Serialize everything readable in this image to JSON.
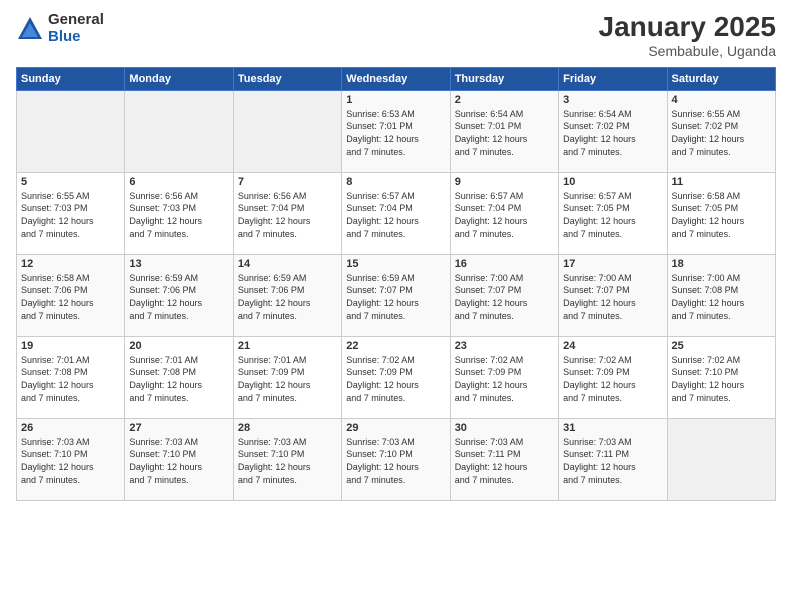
{
  "logo": {
    "general": "General",
    "blue": "Blue"
  },
  "header": {
    "month": "January 2025",
    "location": "Sembabule, Uganda"
  },
  "weekdays": [
    "Sunday",
    "Monday",
    "Tuesday",
    "Wednesday",
    "Thursday",
    "Friday",
    "Saturday"
  ],
  "weeks": [
    [
      {
        "day": "",
        "info": ""
      },
      {
        "day": "",
        "info": ""
      },
      {
        "day": "",
        "info": ""
      },
      {
        "day": "1",
        "info": "Sunrise: 6:53 AM\nSunset: 7:01 PM\nDaylight: 12 hours\nand 7 minutes."
      },
      {
        "day": "2",
        "info": "Sunrise: 6:54 AM\nSunset: 7:01 PM\nDaylight: 12 hours\nand 7 minutes."
      },
      {
        "day": "3",
        "info": "Sunrise: 6:54 AM\nSunset: 7:02 PM\nDaylight: 12 hours\nand 7 minutes."
      },
      {
        "day": "4",
        "info": "Sunrise: 6:55 AM\nSunset: 7:02 PM\nDaylight: 12 hours\nand 7 minutes."
      }
    ],
    [
      {
        "day": "5",
        "info": "Sunrise: 6:55 AM\nSunset: 7:03 PM\nDaylight: 12 hours\nand 7 minutes."
      },
      {
        "day": "6",
        "info": "Sunrise: 6:56 AM\nSunset: 7:03 PM\nDaylight: 12 hours\nand 7 minutes."
      },
      {
        "day": "7",
        "info": "Sunrise: 6:56 AM\nSunset: 7:04 PM\nDaylight: 12 hours\nand 7 minutes."
      },
      {
        "day": "8",
        "info": "Sunrise: 6:57 AM\nSunset: 7:04 PM\nDaylight: 12 hours\nand 7 minutes."
      },
      {
        "day": "9",
        "info": "Sunrise: 6:57 AM\nSunset: 7:04 PM\nDaylight: 12 hours\nand 7 minutes."
      },
      {
        "day": "10",
        "info": "Sunrise: 6:57 AM\nSunset: 7:05 PM\nDaylight: 12 hours\nand 7 minutes."
      },
      {
        "day": "11",
        "info": "Sunrise: 6:58 AM\nSunset: 7:05 PM\nDaylight: 12 hours\nand 7 minutes."
      }
    ],
    [
      {
        "day": "12",
        "info": "Sunrise: 6:58 AM\nSunset: 7:06 PM\nDaylight: 12 hours\nand 7 minutes."
      },
      {
        "day": "13",
        "info": "Sunrise: 6:59 AM\nSunset: 7:06 PM\nDaylight: 12 hours\nand 7 minutes."
      },
      {
        "day": "14",
        "info": "Sunrise: 6:59 AM\nSunset: 7:06 PM\nDaylight: 12 hours\nand 7 minutes."
      },
      {
        "day": "15",
        "info": "Sunrise: 6:59 AM\nSunset: 7:07 PM\nDaylight: 12 hours\nand 7 minutes."
      },
      {
        "day": "16",
        "info": "Sunrise: 7:00 AM\nSunset: 7:07 PM\nDaylight: 12 hours\nand 7 minutes."
      },
      {
        "day": "17",
        "info": "Sunrise: 7:00 AM\nSunset: 7:07 PM\nDaylight: 12 hours\nand 7 minutes."
      },
      {
        "day": "18",
        "info": "Sunrise: 7:00 AM\nSunset: 7:08 PM\nDaylight: 12 hours\nand 7 minutes."
      }
    ],
    [
      {
        "day": "19",
        "info": "Sunrise: 7:01 AM\nSunset: 7:08 PM\nDaylight: 12 hours\nand 7 minutes."
      },
      {
        "day": "20",
        "info": "Sunrise: 7:01 AM\nSunset: 7:08 PM\nDaylight: 12 hours\nand 7 minutes."
      },
      {
        "day": "21",
        "info": "Sunrise: 7:01 AM\nSunset: 7:09 PM\nDaylight: 12 hours\nand 7 minutes."
      },
      {
        "day": "22",
        "info": "Sunrise: 7:02 AM\nSunset: 7:09 PM\nDaylight: 12 hours\nand 7 minutes."
      },
      {
        "day": "23",
        "info": "Sunrise: 7:02 AM\nSunset: 7:09 PM\nDaylight: 12 hours\nand 7 minutes."
      },
      {
        "day": "24",
        "info": "Sunrise: 7:02 AM\nSunset: 7:09 PM\nDaylight: 12 hours\nand 7 minutes."
      },
      {
        "day": "25",
        "info": "Sunrise: 7:02 AM\nSunset: 7:10 PM\nDaylight: 12 hours\nand 7 minutes."
      }
    ],
    [
      {
        "day": "26",
        "info": "Sunrise: 7:03 AM\nSunset: 7:10 PM\nDaylight: 12 hours\nand 7 minutes."
      },
      {
        "day": "27",
        "info": "Sunrise: 7:03 AM\nSunset: 7:10 PM\nDaylight: 12 hours\nand 7 minutes."
      },
      {
        "day": "28",
        "info": "Sunrise: 7:03 AM\nSunset: 7:10 PM\nDaylight: 12 hours\nand 7 minutes."
      },
      {
        "day": "29",
        "info": "Sunrise: 7:03 AM\nSunset: 7:10 PM\nDaylight: 12 hours\nand 7 minutes."
      },
      {
        "day": "30",
        "info": "Sunrise: 7:03 AM\nSunset: 7:11 PM\nDaylight: 12 hours\nand 7 minutes."
      },
      {
        "day": "31",
        "info": "Sunrise: 7:03 AM\nSunset: 7:11 PM\nDaylight: 12 hours\nand 7 minutes."
      },
      {
        "day": "",
        "info": ""
      }
    ]
  ]
}
